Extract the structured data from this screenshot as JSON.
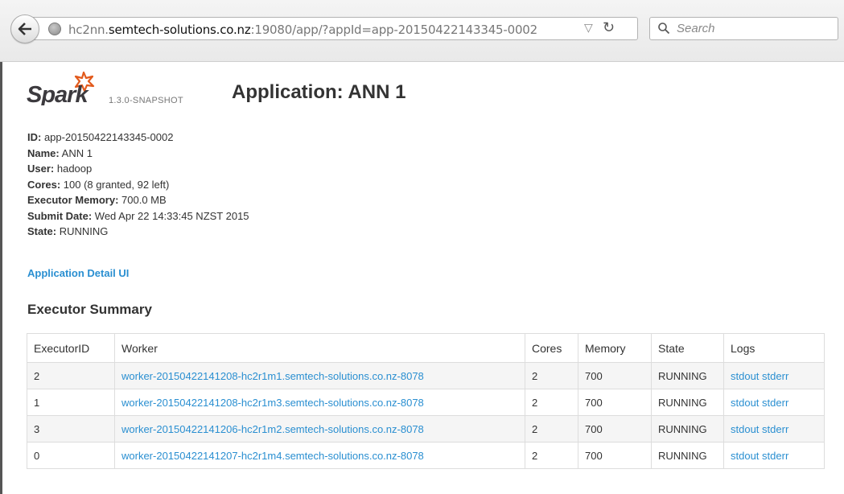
{
  "browser": {
    "url_prefix": "hc2nn.",
    "url_host": "semtech-solutions.co.nz",
    "url_suffix": ":19080/app/?appId=app-20150422143345-0002",
    "search_placeholder": "Search"
  },
  "header": {
    "logo_text": "Spark",
    "version": "1.3.0-SNAPSHOT",
    "title": "Application: ANN 1"
  },
  "info": [
    {
      "label": "ID:",
      "value": " app-20150422143345-0002"
    },
    {
      "label": "Name:",
      "value": " ANN 1"
    },
    {
      "label": "User:",
      "value": " hadoop"
    },
    {
      "label": "Cores:",
      "value": " 100 (8 granted, 92 left)"
    },
    {
      "label": "Executor Memory:",
      "value": " 700.0 MB"
    },
    {
      "label": "Submit Date:",
      "value": " Wed Apr 22 14:33:45 NZST 2015"
    },
    {
      "label": "State:",
      "value": " RUNNING"
    }
  ],
  "detail_link": "Application Detail UI",
  "executor_summary": {
    "title": "Executor Summary",
    "columns": [
      "ExecutorID",
      "Worker",
      "Cores",
      "Memory",
      "State",
      "Logs"
    ],
    "rows": [
      {
        "id": "2",
        "worker": "worker-20150422141208-hc2r1m1.semtech-solutions.co.nz-8078",
        "cores": "2",
        "memory": "700",
        "state": "RUNNING",
        "stdout": "stdout",
        "stderr": "stderr"
      },
      {
        "id": "1",
        "worker": "worker-20150422141208-hc2r1m3.semtech-solutions.co.nz-8078",
        "cores": "2",
        "memory": "700",
        "state": "RUNNING",
        "stdout": "stdout",
        "stderr": "stderr"
      },
      {
        "id": "3",
        "worker": "worker-20150422141206-hc2r1m2.semtech-solutions.co.nz-8078",
        "cores": "2",
        "memory": "700",
        "state": "RUNNING",
        "stdout": "stdout",
        "stderr": "stderr"
      },
      {
        "id": "0",
        "worker": "worker-20150422141207-hc2r1m4.semtech-solutions.co.nz-8078",
        "cores": "2",
        "memory": "700",
        "state": "RUNNING",
        "stdout": "stdout",
        "stderr": "stderr"
      }
    ]
  },
  "colors": {
    "link": "#2a8fd1",
    "logo_orange": "#e25a1c",
    "logo_text": "#3c3a3e"
  }
}
